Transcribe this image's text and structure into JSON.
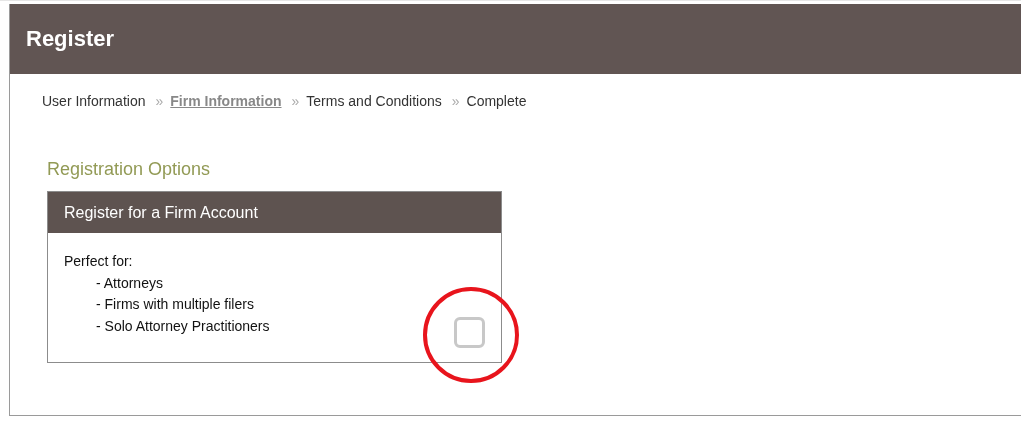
{
  "page": {
    "title": "Register"
  },
  "breadcrumb": [
    {
      "label": "User Information",
      "selected": false
    },
    {
      "label": "Firm Information",
      "selected": true
    },
    {
      "label": "Terms and Conditions",
      "selected": false
    },
    {
      "label": "Complete",
      "selected": false
    }
  ],
  "breadcrumb_separator": "»",
  "section_title": "Registration Options",
  "option": {
    "title": "Register for a Firm Account",
    "intro": "Perfect for:",
    "items": [
      "- Attorneys",
      "- Firms with multiple filers",
      "- Solo Attorney Practitioners"
    ],
    "checked": false
  },
  "annotation": {
    "kind": "circle",
    "color": "#e8141c"
  }
}
